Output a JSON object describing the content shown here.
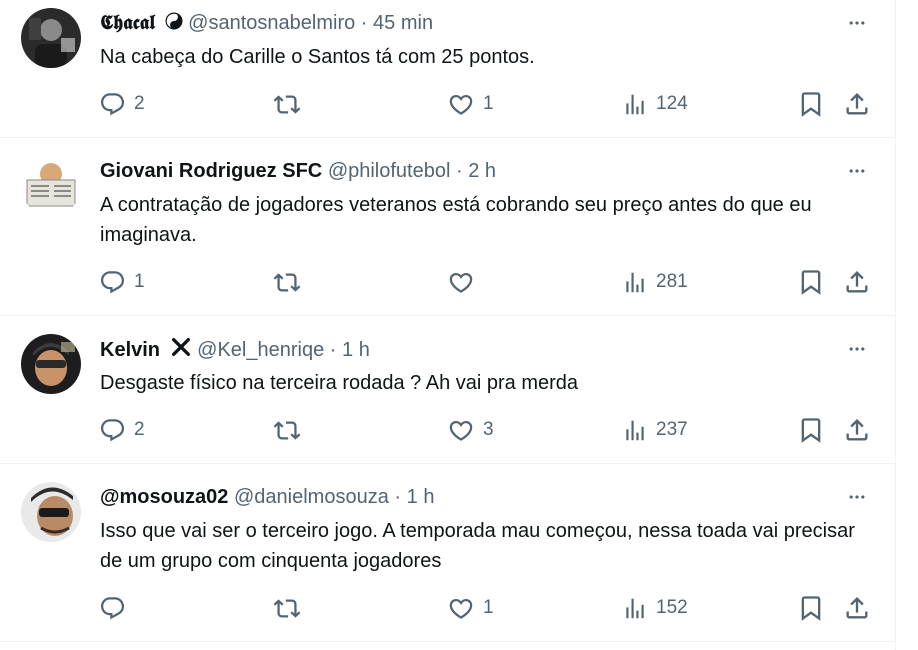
{
  "tweets": [
    {
      "display_name": "𝕮𝖍𝖆𝖈𝖆𝖑",
      "badge_icon": "yin-yang-icon",
      "handle": "@santosnabelmiro",
      "dot": "·",
      "time": "45 min",
      "text": "Na cabeça do Carille o Santos tá com 25 pontos.",
      "replies": "2",
      "retweets": "",
      "likes": "1",
      "views": "124"
    },
    {
      "display_name": "Giovani Rodriguez SFC",
      "handle": "@philofutebol",
      "dot": "·",
      "time": "2 h",
      "text": "A contratação de jogadores veteranos está cobrando seu preço antes do que eu imaginava.",
      "replies": "1",
      "retweets": "",
      "likes": "",
      "views": "281"
    },
    {
      "display_name": "Kelvin",
      "badge_icon": "x-mark-icon",
      "handle": "@Kel_henriqe",
      "dot": "·",
      "time": "1 h",
      "text": "Desgaste físico na terceira rodada ? Ah vai pra merda",
      "replies": "2",
      "retweets": "",
      "likes": "3",
      "views": "237"
    },
    {
      "display_name": "@mosouza02",
      "handle": "@danielmosouza",
      "dot": "·",
      "time": "1 h",
      "text": "Isso que  vai ser o terceiro jogo. A temporada mau começou, nessa toada vai precisar de um grupo com cinquenta jogadores",
      "replies": "",
      "retweets": "",
      "likes": "1",
      "views": "152"
    }
  ],
  "colors": {
    "text_primary": "#0f1419",
    "text_secondary": "#536471",
    "divider": "#eff3f4"
  }
}
